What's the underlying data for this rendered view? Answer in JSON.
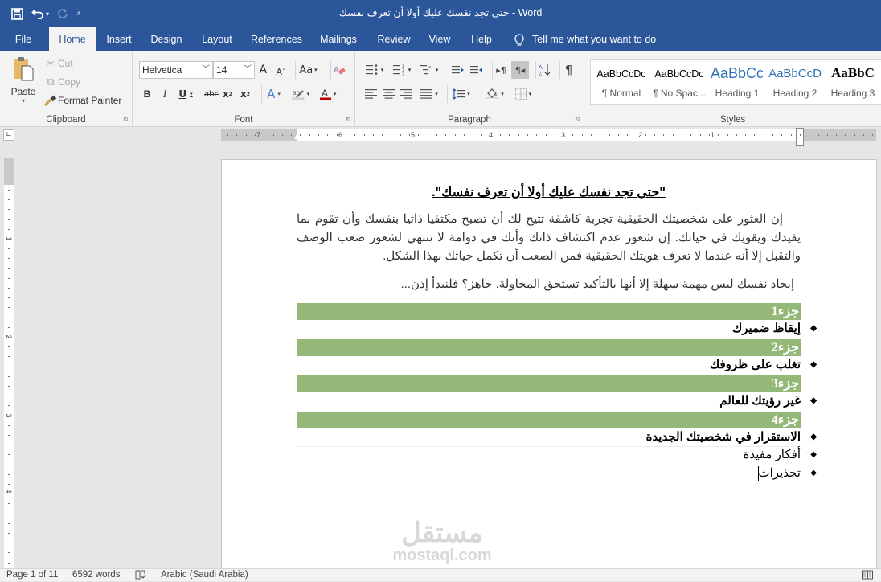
{
  "app": {
    "window_title": "حتى تجد نفسك عليك أولا أن تعرف نفسك  -  Word",
    "qat": {
      "save_icon": "save-icon",
      "undo_icon": "undo-icon",
      "redo_icon": "redo-icon",
      "customize_icon": "customize-qat-icon"
    }
  },
  "tabs": [
    {
      "label": "File"
    },
    {
      "label": "Home",
      "active": true
    },
    {
      "label": "Insert"
    },
    {
      "label": "Design"
    },
    {
      "label": "Layout"
    },
    {
      "label": "References"
    },
    {
      "label": "Mailings"
    },
    {
      "label": "Review"
    },
    {
      "label": "View"
    },
    {
      "label": "Help"
    }
  ],
  "tell_me": "Tell me what you want to do",
  "ribbon": {
    "clipboard": {
      "label": "Clipboard",
      "paste": "Paste",
      "cut": "Cut",
      "copy": "Copy",
      "format_painter": "Format Painter"
    },
    "font": {
      "label": "Font",
      "font_name": "Helvetica",
      "font_size": "14",
      "change_case": "Aa"
    },
    "paragraph": {
      "label": "Paragraph"
    },
    "styles": {
      "label": "Styles",
      "items": [
        {
          "preview": "AaBbCcDc",
          "name": "¶ Normal"
        },
        {
          "preview": "AaBbCcDc",
          "name": "¶ No Spac..."
        },
        {
          "preview": "AaBbCc",
          "name": "Heading 1"
        },
        {
          "preview": "AaBbCcD",
          "name": "Heading 2"
        },
        {
          "preview": "AaBbC",
          "name": "Heading 3"
        }
      ]
    }
  },
  "ruler": {
    "h_numbers": [
      "7",
      "6",
      "5",
      "4",
      "3",
      "2",
      "1"
    ],
    "v_numbers": [
      "1",
      "2",
      "3",
      "4"
    ]
  },
  "document": {
    "title": "\"حتى تجد نفسك عليك أولا أن تعرف نفسك\".",
    "paragraph1": "إن العثور على شخصيتك الحقيقية تجربة كاشفة تتيح لك أن تصبح مكتفيا ذاتيا بنفسك وأن تقوم بما يفيدك ويقويك في حياتك. إن شعور عدم اكتشاف ذاتك وأنك في دوامة لا تنتهي لشعور صعب الوصف والتقبل إلا أنه عندما لا تعرف هويتك الحقيقية فمن الصعب أن تكمل حياتك بهذا الشكل.",
    "paragraph2": "إيجاد نفسك ليس مهمة سهلة إلا أنها بالتأكيد تستحق المحاولة. جاهز؟ فلنبدأ إذن...",
    "sections": [
      {
        "heading": "جزء1",
        "bullets": [
          {
            "text": "إيقاظ ضميرك",
            "bold": true
          }
        ]
      },
      {
        "heading": "جزء2",
        "bullets": [
          {
            "text": "تغلب على ظروفك",
            "bold": true
          }
        ]
      },
      {
        "heading": "جزء3",
        "bullets": [
          {
            "text": "غير رؤيتك للعالم",
            "bold": true
          }
        ]
      },
      {
        "heading": "جزء4",
        "bullets": [
          {
            "text": "الاستقرار في شخصيتك الجديدة",
            "bold": true
          },
          {
            "text": "أفكار مفيدة",
            "bold": false
          },
          {
            "text": "تحذيرات",
            "bold": false
          }
        ]
      }
    ],
    "band_color": "#93b877"
  },
  "watermark": {
    "arabic": "مستقل",
    "latin": "mostaql.com"
  },
  "status": {
    "page": "Page 1 of 11",
    "words": "6592 words",
    "proofing_icon": "proofing-icon",
    "language": "Arabic (Saudi Arabia)",
    "read_mode_icon": "read-mode-icon"
  }
}
